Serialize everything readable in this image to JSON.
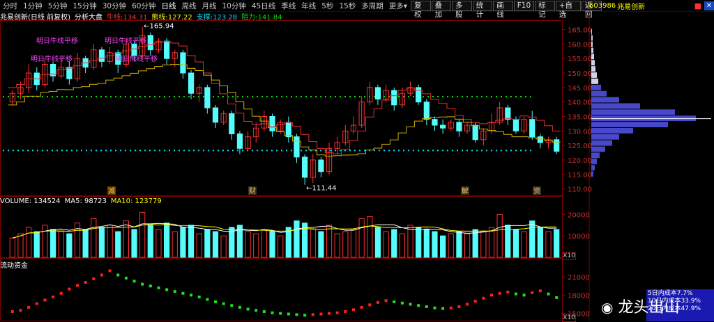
{
  "toolbar": {
    "timeframes": [
      "分时",
      "1分钟",
      "5分钟",
      "15分钟",
      "30分钟",
      "60分钟",
      "日线",
      "周线",
      "月线",
      "10分钟",
      "45日线",
      "季线",
      "年线",
      "5秒",
      "15秒",
      "多周期",
      "更多▾"
    ],
    "active_timeframe": "日线",
    "tools": [
      "复权",
      "叠加",
      "多股",
      "统计",
      "画线",
      "F10",
      "标记",
      "+自选",
      "返回"
    ]
  },
  "right_header": {
    "code": "603986",
    "name": "兆易创新"
  },
  "info": {
    "title": "兆易创新(日线 前复权)",
    "indicator": "分析大盘",
    "ma_label": "牛线:",
    "ma_value": "134.31",
    "bear_label": "熊线:",
    "bear_value": "127.22",
    "support_label": "支撑:",
    "support_value": "123.28",
    "resist_label": "阻力:",
    "resist_value": "141.84"
  },
  "annotations": {
    "high": "165.94",
    "low": "111.44",
    "bull_move_1": "明日牛线平移",
    "bull_move_2": "明日牛线平移",
    "bull_move_3": "明日熊线平移",
    "bear_move": "明日牛线平移",
    "bear_move_2": "明日熊线平移",
    "mark_a": "减",
    "mark_b": "财",
    "mark_c": "解",
    "mark_d": "资"
  },
  "volume": {
    "label": "VOLUME: 134524",
    "ma5": "MA5: 98723",
    "ma10": "MA10: 123779",
    "axis": [
      "20000",
      "10000"
    ],
    "unit": "X10"
  },
  "flow": {
    "label": "流动资金",
    "axis": [
      "21000",
      "18000",
      "15000"
    ],
    "unit": "X10"
  },
  "main_axis": [
    "165.00",
    "160.00",
    "155.00",
    "150.00",
    "145.00",
    "140.00",
    "135.00",
    "130.00",
    "125.00",
    "120.00",
    "115.00",
    "110.00"
  ],
  "legend_panel": [
    "5日内成本7.7%",
    "10日内成本33.9%",
    "20日内成本47.9%"
  ],
  "watermark": "龙头出山",
  "colors": {
    "up": "#ff3030",
    "down": "#54fcfc",
    "ma_yellow": "#ffff00",
    "bear_red": "#e03030",
    "support": "#00e0ff",
    "resist": "#00e000"
  },
  "chart_data": {
    "type": "candlestick",
    "title": "兆易创新(日线 前复权)",
    "ylim": [
      108,
      168
    ],
    "candles": [
      {
        "o": 140,
        "c": 143,
        "h": 144,
        "l": 139
      },
      {
        "o": 143,
        "c": 145,
        "h": 147,
        "l": 141
      },
      {
        "o": 145,
        "c": 150,
        "h": 153,
        "l": 143
      },
      {
        "o": 150,
        "c": 146,
        "h": 152,
        "l": 144
      },
      {
        "o": 146,
        "c": 153,
        "h": 155,
        "l": 145
      },
      {
        "o": 153,
        "c": 149,
        "h": 154,
        "l": 147
      },
      {
        "o": 149,
        "c": 152,
        "h": 155,
        "l": 148
      },
      {
        "o": 152,
        "c": 148,
        "h": 154,
        "l": 146
      },
      {
        "o": 148,
        "c": 155,
        "h": 157,
        "l": 147
      },
      {
        "o": 155,
        "c": 152,
        "h": 156,
        "l": 150
      },
      {
        "o": 152,
        "c": 158,
        "h": 160,
        "l": 151
      },
      {
        "o": 158,
        "c": 154,
        "h": 159,
        "l": 152
      },
      {
        "o": 154,
        "c": 157,
        "h": 159,
        "l": 153
      },
      {
        "o": 157,
        "c": 153,
        "h": 158,
        "l": 150
      },
      {
        "o": 153,
        "c": 160,
        "h": 162,
        "l": 152
      },
      {
        "o": 160,
        "c": 156,
        "h": 161,
        "l": 154
      },
      {
        "o": 156,
        "c": 163,
        "h": 165.94,
        "l": 155
      },
      {
        "o": 163,
        "c": 158,
        "h": 164,
        "l": 156
      },
      {
        "o": 158,
        "c": 161,
        "h": 162,
        "l": 157
      },
      {
        "o": 161,
        "c": 155,
        "h": 162,
        "l": 153
      },
      {
        "o": 155,
        "c": 157,
        "h": 158,
        "l": 152
      },
      {
        "o": 157,
        "c": 150,
        "h": 158,
        "l": 148
      },
      {
        "o": 150,
        "c": 143,
        "h": 151,
        "l": 141
      },
      {
        "o": 143,
        "c": 145,
        "h": 146,
        "l": 140
      },
      {
        "o": 145,
        "c": 138,
        "h": 146,
        "l": 136
      },
      {
        "o": 138,
        "c": 133,
        "h": 139,
        "l": 131
      },
      {
        "o": 133,
        "c": 136,
        "h": 137,
        "l": 132
      },
      {
        "o": 136,
        "c": 129,
        "h": 137,
        "l": 127
      },
      {
        "o": 129,
        "c": 124,
        "h": 130,
        "l": 122
      },
      {
        "o": 124,
        "c": 128,
        "h": 130,
        "l": 123
      },
      {
        "o": 128,
        "c": 131,
        "h": 133,
        "l": 126
      },
      {
        "o": 131,
        "c": 135,
        "h": 137,
        "l": 130
      },
      {
        "o": 135,
        "c": 130,
        "h": 136,
        "l": 128
      },
      {
        "o": 130,
        "c": 133,
        "h": 134,
        "l": 129
      },
      {
        "o": 133,
        "c": 128,
        "h": 135,
        "l": 126
      },
      {
        "o": 128,
        "c": 121,
        "h": 129,
        "l": 119
      },
      {
        "o": 121,
        "c": 114,
        "h": 122,
        "l": 111.44
      },
      {
        "o": 114,
        "c": 120,
        "h": 122,
        "l": 112
      },
      {
        "o": 120,
        "c": 116,
        "h": 121,
        "l": 114
      },
      {
        "o": 116,
        "c": 124,
        "h": 126,
        "l": 115
      },
      {
        "o": 124,
        "c": 126,
        "h": 128,
        "l": 122
      },
      {
        "o": 126,
        "c": 130,
        "h": 132,
        "l": 125
      },
      {
        "o": 130,
        "c": 132,
        "h": 135,
        "l": 129
      },
      {
        "o": 132,
        "c": 140,
        "h": 142,
        "l": 131
      },
      {
        "o": 140,
        "c": 145,
        "h": 147,
        "l": 139
      },
      {
        "o": 145,
        "c": 141,
        "h": 146,
        "l": 139
      },
      {
        "o": 141,
        "c": 144,
        "h": 146,
        "l": 140
      },
      {
        "o": 144,
        "c": 139,
        "h": 145,
        "l": 137
      },
      {
        "o": 139,
        "c": 143,
        "h": 145,
        "l": 138
      },
      {
        "o": 143,
        "c": 145,
        "h": 147,
        "l": 142
      },
      {
        "o": 145,
        "c": 140,
        "h": 146,
        "l": 139
      },
      {
        "o": 140,
        "c": 134,
        "h": 141,
        "l": 132
      },
      {
        "o": 134,
        "c": 132,
        "h": 135,
        "l": 130
      },
      {
        "o": 132,
        "c": 131,
        "h": 134,
        "l": 129
      },
      {
        "o": 131,
        "c": 133,
        "h": 134,
        "l": 130
      },
      {
        "o": 133,
        "c": 130,
        "h": 134,
        "l": 128
      },
      {
        "o": 130,
        "c": 132,
        "h": 133,
        "l": 129
      },
      {
        "o": 132,
        "c": 127,
        "h": 133,
        "l": 126
      },
      {
        "o": 127,
        "c": 130,
        "h": 131,
        "l": 125
      },
      {
        "o": 130,
        "c": 133,
        "h": 136,
        "l": 129
      },
      {
        "o": 133,
        "c": 138,
        "h": 140,
        "l": 132
      },
      {
        "o": 138,
        "c": 134,
        "h": 139,
        "l": 132
      },
      {
        "o": 134,
        "c": 130,
        "h": 135,
        "l": 129
      },
      {
        "o": 130,
        "c": 134,
        "h": 135,
        "l": 129
      },
      {
        "o": 134,
        "c": 128,
        "h": 137,
        "l": 127
      },
      {
        "o": 128,
        "c": 126,
        "h": 129,
        "l": 124
      },
      {
        "o": 126,
        "c": 127,
        "h": 128,
        "l": 124
      },
      {
        "o": 127,
        "c": 123,
        "h": 128,
        "l": 122
      }
    ],
    "volume": [
      9000,
      11000,
      14000,
      12000,
      15000,
      13000,
      12000,
      11000,
      16000,
      13000,
      18000,
      14000,
      15000,
      12000,
      17000,
      13000,
      21000,
      15000,
      13000,
      16000,
      12000,
      14000,
      15000,
      11000,
      13000,
      12000,
      10000,
      14000,
      15000,
      12000,
      11000,
      13000,
      12000,
      10000,
      14000,
      17000,
      16000,
      13000,
      12000,
      15000,
      11000,
      12000,
      13000,
      18000,
      19000,
      14000,
      12000,
      13000,
      11000,
      15000,
      14000,
      13000,
      12000,
      10000,
      11000,
      12000,
      11000,
      13000,
      12000,
      14000,
      20000,
      15000,
      13000,
      12000,
      17000,
      14000,
      12000,
      13000
    ],
    "flow": [
      15300,
      15500,
      16000,
      16600,
      17200,
      17700,
      18300,
      19000,
      19600,
      20100,
      20700,
      21300,
      22000,
      21300,
      20800,
      20300,
      19800,
      19500,
      19200,
      18900,
      18600,
      18300,
      18000,
      17700,
      17300,
      16900,
      16600,
      16300,
      16000,
      15700,
      15500,
      15300,
      15100,
      15000,
      14900,
      14800,
      14700,
      14800,
      14900,
      15000,
      15100,
      15300,
      15600,
      16000,
      16400,
      16800,
      17100,
      16900,
      16700,
      16500,
      16300,
      16100,
      15900,
      15800,
      15900,
      16100,
      16500,
      17000,
      17500,
      18000,
      18300,
      18500,
      18200,
      18000,
      18400,
      18700,
      18200,
      17600
    ]
  }
}
